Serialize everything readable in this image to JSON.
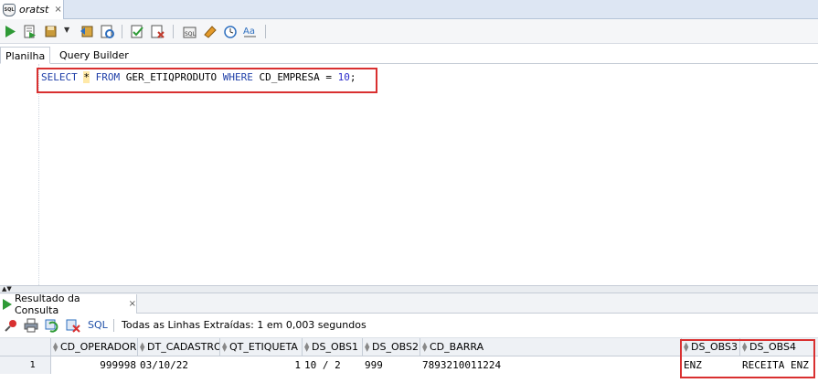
{
  "document_tab": {
    "title": "oratst",
    "icon": "database-sql-icon",
    "close": "×"
  },
  "toolbar": {
    "icons": [
      "run-statement-icon",
      "run-script-icon",
      "commit-icon",
      "rollback-icon",
      "explain-plan-icon",
      "autotrace-icon",
      "sql-tuning-icon",
      "clear-icon",
      "history-icon",
      "format-icon"
    ]
  },
  "sub_tabs": {
    "worksheet": "Planilha",
    "query_builder": "Query Builder"
  },
  "editor": {
    "tokens": {
      "select": "SELECT",
      "star": "*",
      "from": "FROM",
      "table": "GER_ETIQPRODUTO",
      "where": "WHERE",
      "column": "CD_EMPRESA",
      "op": "=",
      "value": "10",
      "end": ";"
    }
  },
  "result": {
    "tab_label": "Resultado da Consulta",
    "tab_close": "×",
    "sql_link": "SQL",
    "status": "Todas as Linhas Extraídas: 1 em 0,003 segundos",
    "columns": [
      "CD_OPERADOR",
      "DT_CADASTRO",
      "QT_ETIQUETA",
      "DS_OBS1",
      "DS_OBS2",
      "CD_BARRA",
      "DS_OBS3",
      "DS_OBS4"
    ],
    "rows": [
      {
        "num": "1",
        "cd_operador": "999998",
        "dt_cadastro": "03/10/22",
        "qt_etiqueta": "1",
        "ds_obs1": "10 / 2",
        "ds_obs2": "999",
        "cd_barra": "7893210011224",
        "ds_obs3": "ENZ",
        "ds_obs4": "RECEITA ENZ"
      }
    ]
  },
  "colors": {
    "highlight_border": "#d93030",
    "keyword": "#1f3fa8",
    "number": "#2b2bcc"
  }
}
